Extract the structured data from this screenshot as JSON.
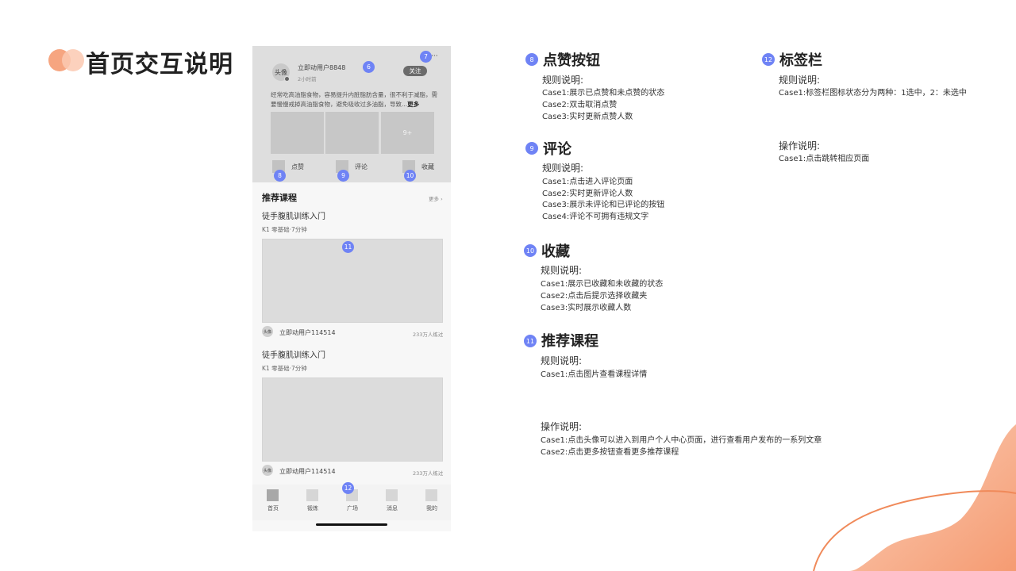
{
  "page": {
    "title": "首页交互说明"
  },
  "phone": {
    "post": {
      "avatar_label": "头像",
      "username": "立即动用户8848",
      "time": "2小时前",
      "follow_label": "关注",
      "more_icon": "···",
      "content": "经常吃高油脂食物，容易提升内脏脂肪含量，很不利于减脂，需要慢慢戒掉高油脂食物，避免吸收过多油脂，导致...",
      "more_link": "更多",
      "image_count": "9+",
      "actions": {
        "like": "点赞",
        "comment": "评论",
        "collect": "收藏"
      }
    },
    "recommend": {
      "title": "推荐课程",
      "more": "更多",
      "courses": [
        {
          "name": "徒手腹肌训练入门",
          "meta": "K1 零基础·7分钟",
          "avatar": "头像",
          "user": "立即动用户114514",
          "count": "233万人练过"
        },
        {
          "name": "徒手腹肌训练入门",
          "meta": "K1 零基础·7分钟",
          "avatar": "头像",
          "user": "立即动用户114514",
          "count": "233万人练过"
        }
      ]
    },
    "tabs": [
      "首页",
      "锻炼",
      "广场",
      "消息",
      "我的"
    ],
    "markers": {
      "m6": "6",
      "m7": "7",
      "m8": "8",
      "m9": "9",
      "m10": "10",
      "m11": "11",
      "m12": "12"
    }
  },
  "annotations": {
    "like": {
      "num": "8",
      "title": "点赞按钮",
      "rule_title": "规则说明:",
      "cases": [
        "Case1:展示已点赞和未点赞的状态",
        "Case2:双击取消点赞",
        "Case3:实时更新点赞人数"
      ]
    },
    "comment": {
      "num": "9",
      "title": "评论",
      "rule_title": "规则说明:",
      "cases": [
        "Case1:点击进入评论页面",
        "Case2:实时更新评论人数",
        "Case3:展示未评论和已评论的按钮",
        "Case4:评论不可拥有违规文字"
      ]
    },
    "collect": {
      "num": "10",
      "title": "收藏",
      "rule_title": "规则说明:",
      "cases": [
        "Case1:展示已收藏和未收藏的状态",
        "Case2:点击后提示选择收藏夹",
        "Case3:实时展示收藏人数"
      ]
    },
    "recommend": {
      "num": "11",
      "title": "推荐课程",
      "rule_title": "规则说明:",
      "cases": [
        "Case1:点击图片查看课程详情"
      ]
    },
    "operation": {
      "title": "操作说明:",
      "cases": [
        "Case1:点击头像可以进入到用户个人中心页面，进行查看用户发布的一系列文章",
        "Case2:点击更多按钮查看更多推荐课程"
      ]
    },
    "tabbar": {
      "num": "12",
      "title": "标签栏",
      "rule_title": "规则说明:",
      "rule_cases": [
        "Case1:标签栏图标状态分为两种：1选中，2：未选中"
      ],
      "op_title": "操作说明:",
      "op_cases": [
        "Case1:点击跳转相应页面"
      ]
    }
  },
  "colors": {
    "accent": "#6f83f5",
    "orange": "#f59b72",
    "light_orange": "#fbc9b1"
  }
}
